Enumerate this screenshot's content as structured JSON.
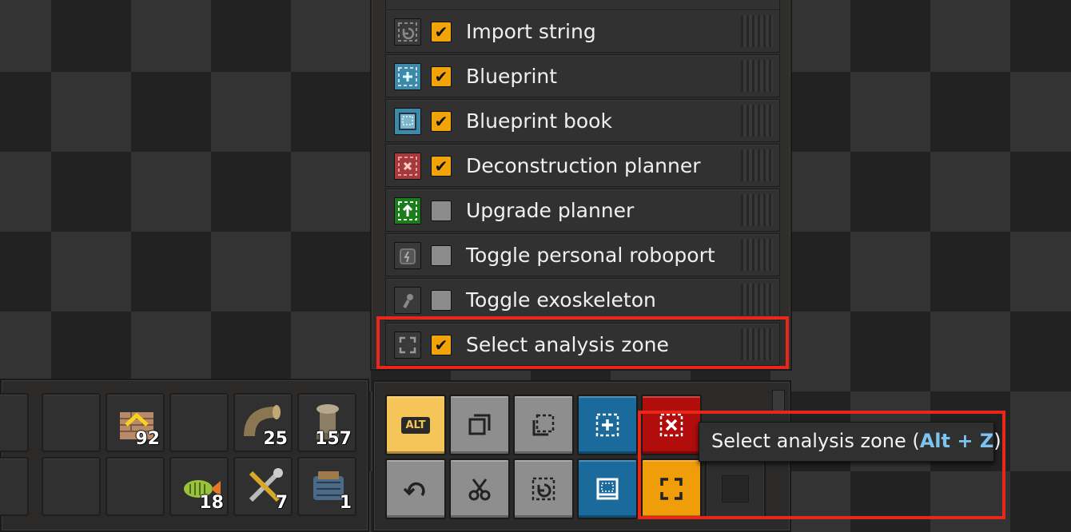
{
  "shortcut_list": {
    "items": [
      {
        "label": "Import string",
        "checked": true,
        "icon": "import-string-icon"
      },
      {
        "label": "Blueprint",
        "checked": true,
        "icon": "blueprint-icon"
      },
      {
        "label": "Blueprint book",
        "checked": true,
        "icon": "blueprint-book-icon"
      },
      {
        "label": "Deconstruction planner",
        "checked": true,
        "icon": "deconstruction-planner-icon"
      },
      {
        "label": "Upgrade planner",
        "checked": false,
        "icon": "upgrade-planner-icon"
      },
      {
        "label": "Toggle personal roboport",
        "checked": false,
        "icon": "roboport-icon"
      },
      {
        "label": "Toggle exoskeleton",
        "checked": false,
        "icon": "exoskeleton-icon"
      },
      {
        "label": "Select analysis zone",
        "checked": true,
        "icon": "analysis-zone-icon"
      }
    ]
  },
  "quickbar": {
    "row1": [
      {
        "item": "",
        "count": ""
      },
      {
        "item": "",
        "count": ""
      },
      {
        "item": "stone-wall-icon",
        "count": "92"
      },
      {
        "item": "",
        "count": ""
      },
      {
        "item": "pipe-icon",
        "count": "25"
      },
      {
        "item": "pipe-to-ground-icon",
        "count": "157"
      }
    ],
    "row2": [
      {
        "item": "",
        "count": ""
      },
      {
        "item": "",
        "count": ""
      },
      {
        "item": "raw-fish-icon",
        "count": "18"
      },
      {
        "item": "repair-pack-icon",
        "count": "7"
      },
      {
        "item": "engine-icon",
        "count": "1"
      }
    ]
  },
  "toolbar": {
    "alt_label": "ALT",
    "buttons_top": [
      "alt-mode-icon",
      "copy-icon",
      "paste-icon",
      "blueprint-icon",
      "deconstruction-planner-icon"
    ],
    "buttons_bottom": [
      "undo-icon",
      "cut-icon",
      "import-string-icon",
      "blueprint-book-icon",
      "select-analysis-zone-icon"
    ]
  },
  "tooltip": {
    "text": "Select analysis zone (",
    "shortcut": "Alt + Z",
    "close": ")"
  },
  "colors": {
    "highlight": "#e8261a",
    "check_on": "#f0a40a",
    "tooltip_key": "#7ec3f0"
  }
}
